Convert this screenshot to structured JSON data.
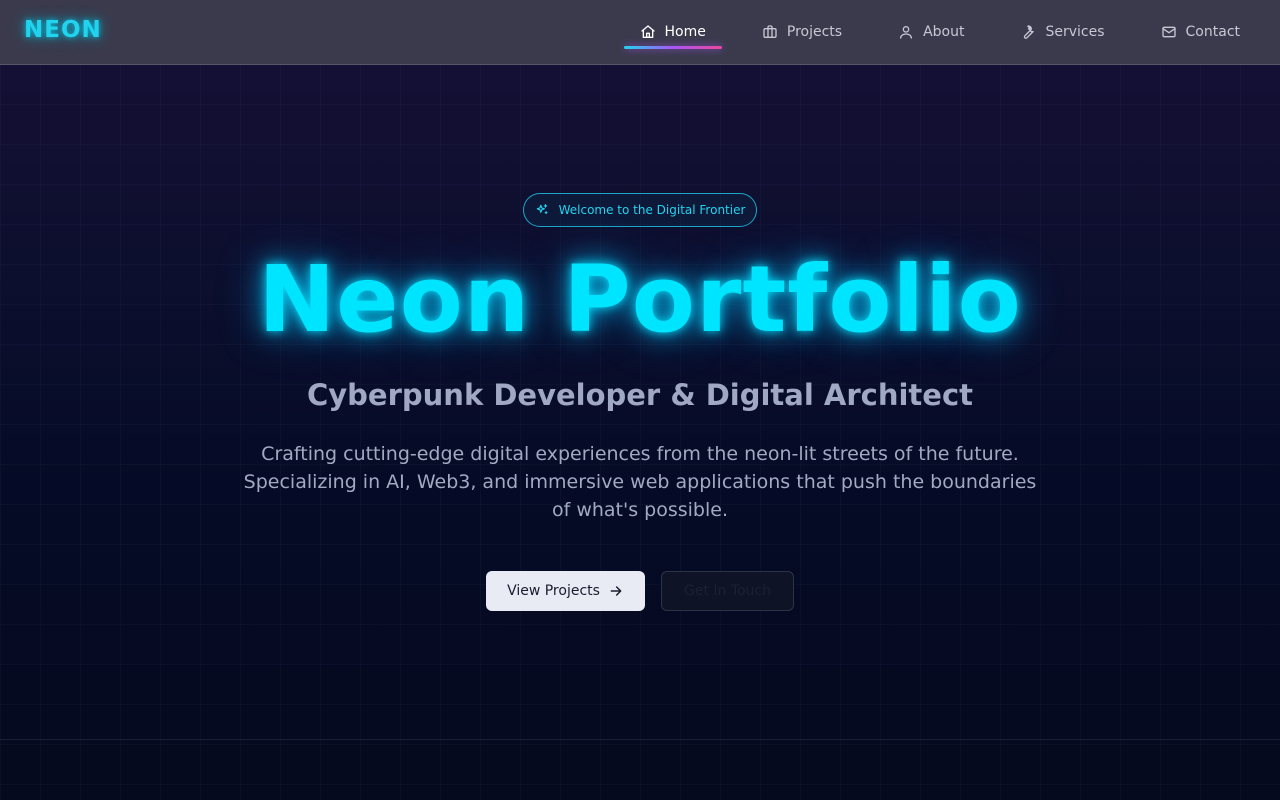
{
  "brand": {
    "logo": "NEON",
    "accent": "#22d3ee"
  },
  "nav": {
    "items": [
      {
        "label": "Home",
        "icon": "home-icon",
        "active": true
      },
      {
        "label": "Projects",
        "icon": "briefcase-icon"
      },
      {
        "label": "About",
        "icon": "user-icon"
      },
      {
        "label": "Services",
        "icon": "wrench-icon"
      },
      {
        "label": "Contact",
        "icon": "mail-icon"
      }
    ]
  },
  "hero": {
    "badge": "Welcome to the Digital Frontier",
    "badge_icon": "sparkles-icon",
    "title": "Neon Portfolio",
    "subtitle": "Cyberpunk Developer & Digital Architect",
    "description": "Crafting cutting-edge digital experiences from the neon-lit streets of the future. Specializing in AI, Web3, and immersive web applications that push the boundaries of what's possible.",
    "primary_button": "View Projects",
    "primary_button_icon": "arrow-right-icon",
    "secondary_button": "Get In Touch"
  },
  "colors": {
    "title_glow": "#00e5ff",
    "active_underline": [
      "#22d3ee",
      "#a855f7",
      "#ec4899"
    ],
    "navbar_bg": "#3a3a4c"
  }
}
